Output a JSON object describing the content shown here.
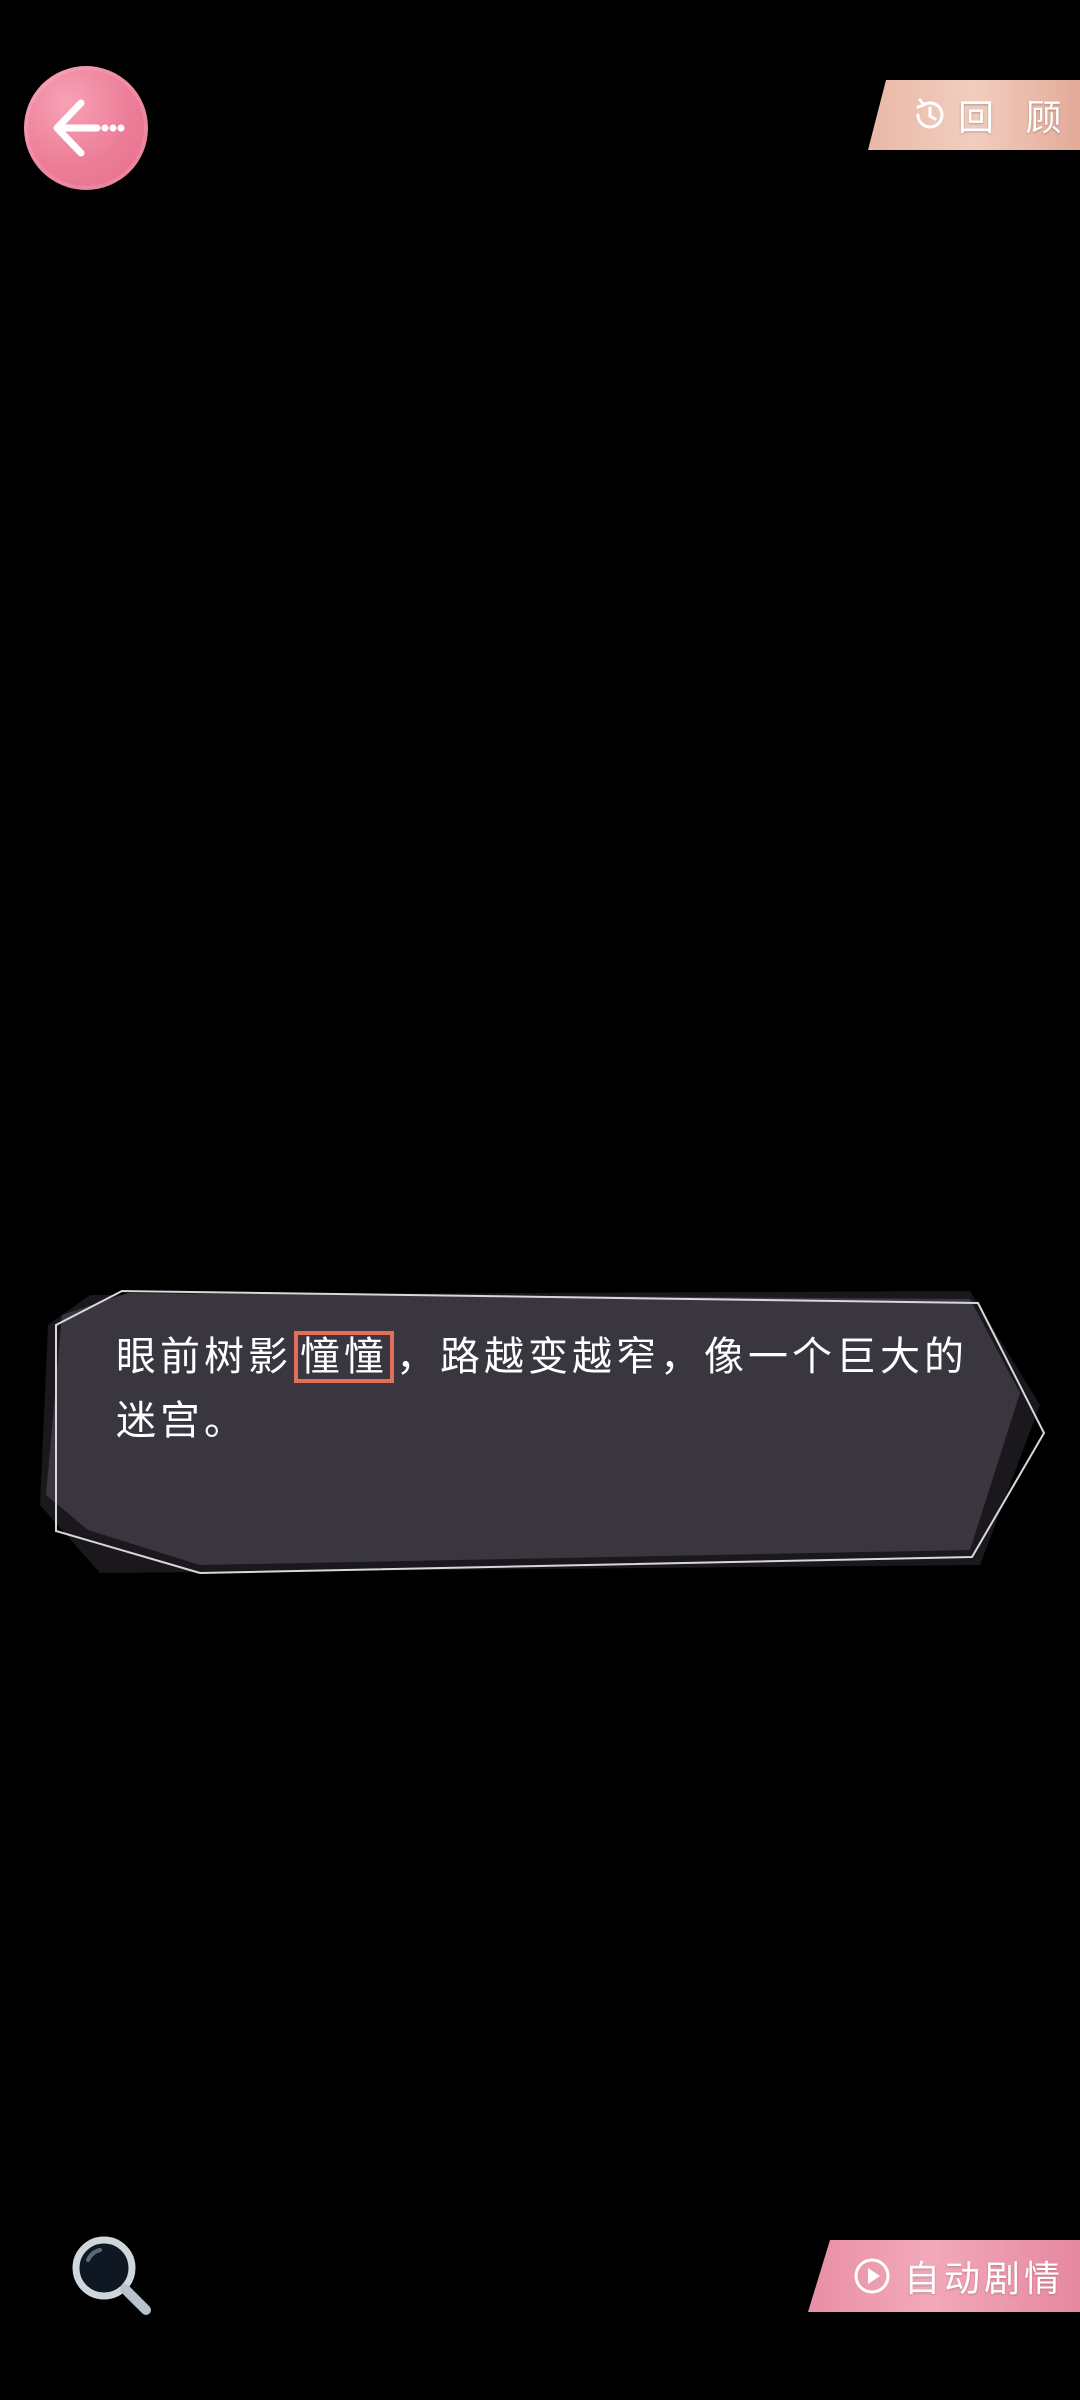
{
  "header": {
    "back_icon": "back-arrow-icon",
    "review_label": "回 顾",
    "review_icon": "history-clock-icon"
  },
  "dialogue": {
    "text_before": "眼前树影",
    "highlight": "憧憧",
    "text_after": "，路越变越窄，像一个巨大的迷宫。"
  },
  "footer": {
    "zoom_icon": "magnifier-icon",
    "auto_label": "自动剧情",
    "auto_icon": "play-circle-icon"
  },
  "colors": {
    "background": "#000000",
    "back_button": "#ec7c97",
    "review_button": "#efc5b6",
    "auto_button": "#f0a3b5",
    "dialog_fill": "#3a3640",
    "highlight_border": "#e06e5a"
  }
}
